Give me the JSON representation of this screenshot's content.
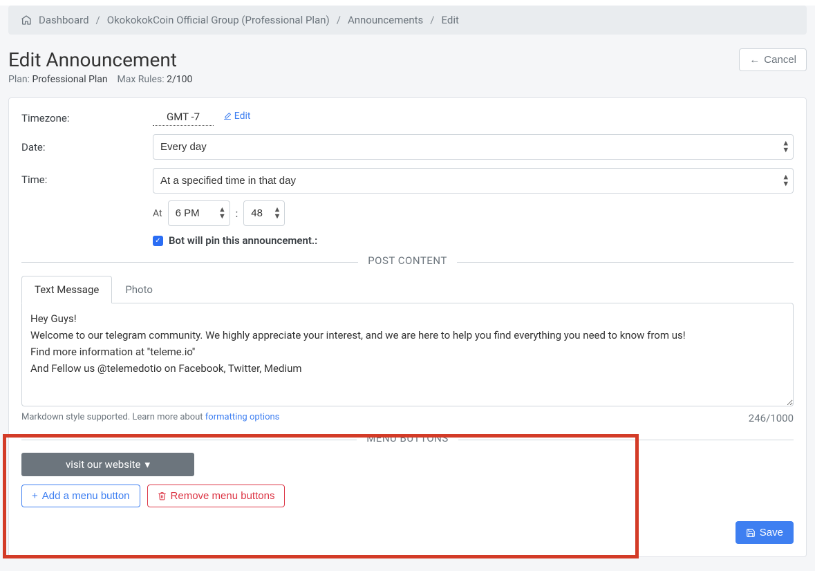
{
  "breadcrumb": {
    "dashboard": "Dashboard",
    "group": "OkokokokCoin Official Group (Professional Plan)",
    "announcements": "Announcements",
    "current": "Edit"
  },
  "page": {
    "title": "Edit Announcement",
    "plan_label": "Plan: ",
    "plan_value": "Professional Plan",
    "maxrules_label": "Max Rules: ",
    "maxrules_value": "2/100",
    "cancel": "Cancel"
  },
  "form": {
    "timezone_label": "Timezone:",
    "timezone_value": "GMT -7",
    "edit": "Edit",
    "date_label": "Date:",
    "date_value": "Every day",
    "time_label": "Time:",
    "time_mode": "At a specified time in that day",
    "at": "At",
    "hour": "6 PM",
    "minute": "48",
    "sep": ":",
    "pin_label": "Bot will pin this announcement.:"
  },
  "post": {
    "section": "POST CONTENT",
    "tab_text": "Text Message",
    "tab_photo": "Photo",
    "body": "Hey Guys!\nWelcome to our telegram community. We highly appreciate your interest, and we are here to help you find everything you need to know from us!\nFind more information at ''teleme.io''\nAnd Fellow us @telemedotio on Facebook, Twitter, Medium",
    "hint_prefix": "Markdown style supported. Learn more about ",
    "hint_link": "formatting options",
    "counter": "246/1000"
  },
  "menu": {
    "section": "MENU BUTTONS",
    "chip": "visit our website",
    "add": "Add a menu button",
    "remove": "Remove menu buttons"
  },
  "save": "Save"
}
